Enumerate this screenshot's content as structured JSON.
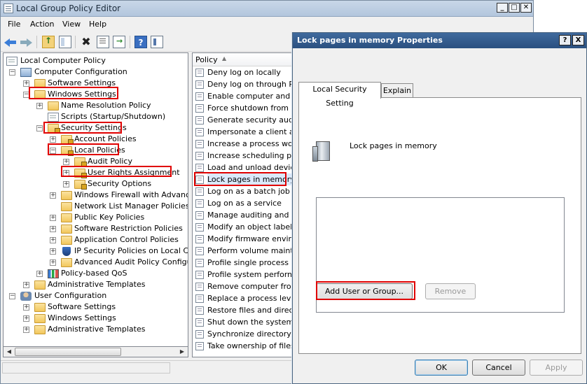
{
  "main_window": {
    "title": "Local Group Policy Editor",
    "menu": [
      "File",
      "Action",
      "View",
      "Help"
    ]
  },
  "tree": {
    "nodes": [
      {
        "label": "Local Computer Policy",
        "icon": "document-icon"
      },
      {
        "label": "Computer Configuration",
        "icon": "computer-icon"
      },
      {
        "label": "Software Settings",
        "icon": "folder-icon"
      },
      {
        "label": "Windows Settings",
        "icon": "folder-icon"
      },
      {
        "label": "Name Resolution Policy",
        "icon": "folder-icon"
      },
      {
        "label": "Scripts (Startup/Shutdown)",
        "icon": "script-icon"
      },
      {
        "label": "Security Settings",
        "icon": "secure-folder-icon"
      },
      {
        "label": "Account Policies",
        "icon": "secure-folder-icon"
      },
      {
        "label": "Local Policies",
        "icon": "secure-folder-icon"
      },
      {
        "label": "Audit Policy",
        "icon": "secure-folder-icon"
      },
      {
        "label": "User Rights Assignment",
        "icon": "secure-folder-icon"
      },
      {
        "label": "Security Options",
        "icon": "secure-folder-icon"
      },
      {
        "label": "Windows Firewall with Advanced S",
        "icon": "folder-icon"
      },
      {
        "label": "Network List Manager Policies",
        "icon": "folder-icon"
      },
      {
        "label": "Public Key Policies",
        "icon": "folder-icon"
      },
      {
        "label": "Software Restriction Policies",
        "icon": "folder-icon"
      },
      {
        "label": "Application Control Policies",
        "icon": "folder-icon"
      },
      {
        "label": "IP Security Policies on Local Compu",
        "icon": "shield-icon"
      },
      {
        "label": "Advanced Audit Policy Configurati",
        "icon": "folder-icon"
      },
      {
        "label": "Policy-based QoS",
        "icon": "chart-icon"
      },
      {
        "label": "Administrative Templates",
        "icon": "folder-icon"
      },
      {
        "label": "User Configuration",
        "icon": "user-icon"
      },
      {
        "label": "Software Settings",
        "icon": "folder-icon"
      },
      {
        "label": "Windows Settings",
        "icon": "folder-icon"
      },
      {
        "label": "Administrative Templates",
        "icon": "folder-icon"
      }
    ]
  },
  "list": {
    "column_header": "Policy",
    "items": [
      "Deny log on locally",
      "Deny log on through Rem",
      "Enable computer and user",
      "Force shutdown from a re",
      "Generate security audits",
      "Impersonate a client after",
      "Increase a process workin",
      "Increase scheduling priori",
      "Load and unload device d",
      "Lock pages in memory",
      "Log on as a batch job",
      "Log on as a service",
      "Manage auditing and secu",
      "Modify an object label",
      "Modify firmware environm",
      "Perform volume maintena",
      "Profile single process",
      "Profile system performanc",
      "Remove computer from do",
      "Replace a process level to",
      "Restore files and directori",
      "Shut down the system",
      "Synchronize directory ser",
      "Take ownership of files or"
    ],
    "selected": "Lock pages in memory"
  },
  "dialog": {
    "title": "Lock pages in memory Properties",
    "help_button": "?",
    "close_button": "X",
    "tabs": [
      "Local Security Setting",
      "Explain"
    ],
    "active_tab": "Local Security Setting",
    "policy_name": "Lock pages in memory",
    "add_button": "Add User or Group...",
    "remove_button": "Remove",
    "ok_button": "OK",
    "cancel_button": "Cancel",
    "apply_button": "Apply"
  },
  "colors": {
    "highlight_box": "#e00000",
    "dialog_titlebar": "#2b5080",
    "folder": "#f2c75c"
  }
}
